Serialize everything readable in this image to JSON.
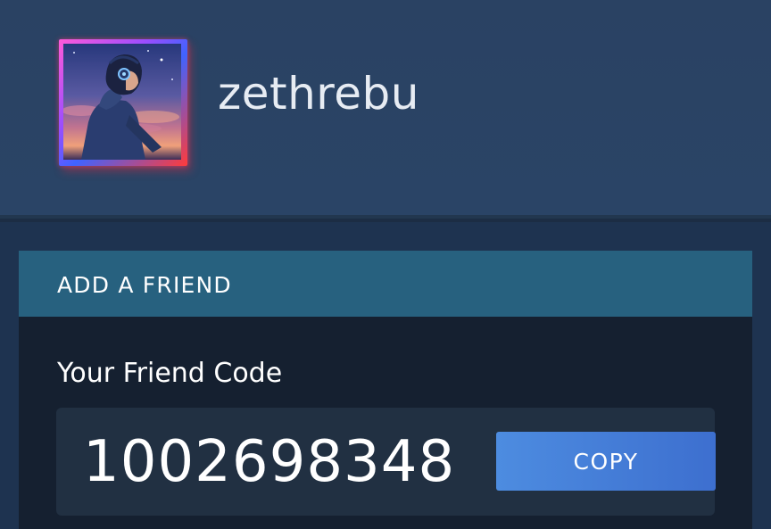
{
  "profile": {
    "username": "zethrebu",
    "avatar": "profile-avatar"
  },
  "add_friend": {
    "title": "ADD A FRIEND",
    "code_label": "Your Friend Code",
    "friend_code": "1002698348",
    "copy_label": "COPY"
  },
  "colors": {
    "background": "#1c2d44",
    "card_header": "#27617f",
    "card_body": "#152030",
    "copy_button": "#4a86de"
  }
}
